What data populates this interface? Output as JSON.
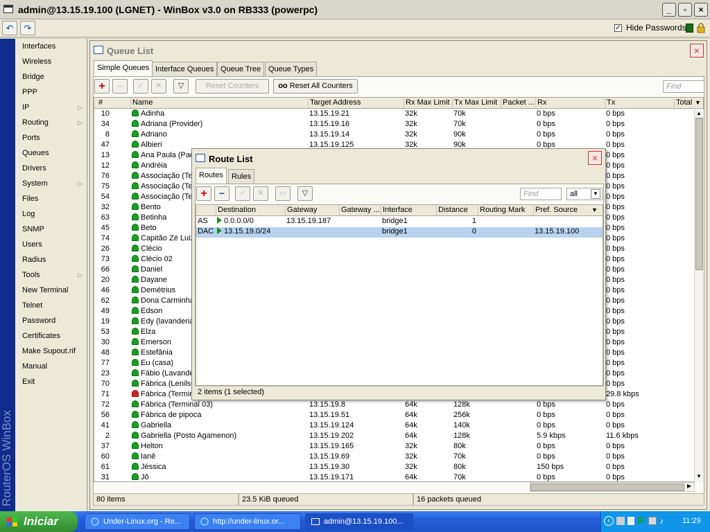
{
  "app": {
    "title": "admin@13.15.19.100 (LGNET) - WinBox v3.0 on RB333 (powerpc)"
  },
  "toolbar": {
    "hide_passwords_label": "Hide Passwords",
    "hide_passwords_checked": true
  },
  "sidebar": {
    "brand": "RouterOS WinBox",
    "items": [
      {
        "label": "Interfaces",
        "has_submenu": false
      },
      {
        "label": "Wireless",
        "has_submenu": false
      },
      {
        "label": "Bridge",
        "has_submenu": false
      },
      {
        "label": "PPP",
        "has_submenu": false
      },
      {
        "label": "IP",
        "has_submenu": true
      },
      {
        "label": "Routing",
        "has_submenu": true
      },
      {
        "label": "Ports",
        "has_submenu": false
      },
      {
        "label": "Queues",
        "has_submenu": false
      },
      {
        "label": "Drivers",
        "has_submenu": false
      },
      {
        "label": "System",
        "has_submenu": true
      },
      {
        "label": "Files",
        "has_submenu": false
      },
      {
        "label": "Log",
        "has_submenu": false
      },
      {
        "label": "SNMP",
        "has_submenu": false
      },
      {
        "label": "Users",
        "has_submenu": false
      },
      {
        "label": "Radius",
        "has_submenu": false
      },
      {
        "label": "Tools",
        "has_submenu": true
      },
      {
        "label": "New Terminal",
        "has_submenu": false
      },
      {
        "label": "Telnet",
        "has_submenu": false
      },
      {
        "label": "Password",
        "has_submenu": false
      },
      {
        "label": "Certificates",
        "has_submenu": false
      },
      {
        "label": "Make Supout.rif",
        "has_submenu": false
      },
      {
        "label": "Manual",
        "has_submenu": false
      },
      {
        "label": "Exit",
        "has_submenu": false
      }
    ]
  },
  "queue_list": {
    "title": "Queue List",
    "tabs": [
      "Simple Queues",
      "Interface Queues",
      "Queue Tree",
      "Queue Types"
    ],
    "active_tab": "Simple Queues",
    "reset_counters": "Reset Counters",
    "reset_all_counters": "Reset All Counters",
    "oo_label": "oo",
    "find_placeholder": "Find",
    "columns": [
      "#",
      "Name",
      "Target Address",
      "Rx Max Limit",
      "Tx Max Limit",
      "Packet ...",
      "Rx",
      "Tx",
      "Total"
    ],
    "rows": [
      {
        "n": "10",
        "name": "Adinha",
        "target": "13.15.19.21",
        "rxmax": "32k",
        "txmax": "70k",
        "rx": "0 bps",
        "tx": "0 bps",
        "status": "green"
      },
      {
        "n": "34",
        "name": "Adriana (Provider)",
        "target": "13.15.19.16",
        "rxmax": "32k",
        "txmax": "70k",
        "rx": "0 bps",
        "tx": "0 bps",
        "status": "green"
      },
      {
        "n": "8",
        "name": "Adriano",
        "target": "13.15.19.14",
        "rxmax": "32k",
        "txmax": "90k",
        "rx": "0 bps",
        "tx": "0 bps",
        "status": "green"
      },
      {
        "n": "47",
        "name": "Albieri",
        "target": "13.15.19.125",
        "rxmax": "32k",
        "txmax": "90k",
        "rx": "0 bps",
        "tx": "0 bps",
        "status": "green"
      },
      {
        "n": "13",
        "name": "Ana Paula (Pad",
        "target": "",
        "rxmax": "",
        "txmax": "",
        "rx": "",
        "tx": "0 bps",
        "status": "green"
      },
      {
        "n": "12",
        "name": "Andréia",
        "target": "",
        "rxmax": "",
        "txmax": "",
        "rx": "",
        "tx": "0 bps",
        "status": "green"
      },
      {
        "n": "76",
        "name": "Associação (Te",
        "target": "",
        "rxmax": "",
        "txmax": "",
        "rx": "",
        "tx": "0 bps",
        "status": "green"
      },
      {
        "n": "75",
        "name": "Associação (Te",
        "target": "",
        "rxmax": "",
        "txmax": "",
        "rx": "",
        "tx": "0 bps",
        "status": "green"
      },
      {
        "n": "54",
        "name": "Associação (Te",
        "target": "",
        "rxmax": "",
        "txmax": "",
        "rx": "",
        "tx": "0 bps",
        "status": "green"
      },
      {
        "n": "32",
        "name": "Bento",
        "target": "",
        "rxmax": "",
        "txmax": "",
        "rx": "",
        "tx": "0 bps",
        "status": "green"
      },
      {
        "n": "63",
        "name": "Betinha",
        "target": "",
        "rxmax": "",
        "txmax": "",
        "rx": "",
        "tx": "0 bps",
        "status": "green"
      },
      {
        "n": "45",
        "name": "Beto",
        "target": "",
        "rxmax": "",
        "txmax": "",
        "rx": "",
        "tx": "0 bps",
        "status": "green"
      },
      {
        "n": "74",
        "name": "Capitão Zé Luiz",
        "target": "",
        "rxmax": "",
        "txmax": "",
        "rx": "",
        "tx": "0 bps",
        "status": "green"
      },
      {
        "n": "26",
        "name": "Clécio",
        "target": "",
        "rxmax": "",
        "txmax": "",
        "rx": "",
        "tx": "0 bps",
        "status": "green"
      },
      {
        "n": "73",
        "name": "Clécio 02",
        "target": "",
        "rxmax": "",
        "txmax": "",
        "rx": "",
        "tx": "0 bps",
        "status": "green"
      },
      {
        "n": "66",
        "name": "Daniel",
        "target": "",
        "rxmax": "",
        "txmax": "",
        "rx": "",
        "tx": "0 bps",
        "status": "green"
      },
      {
        "n": "20",
        "name": "Dayane",
        "target": "",
        "rxmax": "",
        "txmax": "",
        "rx": "",
        "tx": "0 bps",
        "status": "green"
      },
      {
        "n": "46",
        "name": "Demétrius",
        "target": "",
        "rxmax": "",
        "txmax": "",
        "rx": "",
        "tx": "0 bps",
        "status": "green"
      },
      {
        "n": "62",
        "name": "Dona Carminha",
        "target": "",
        "rxmax": "",
        "txmax": "",
        "rx": "",
        "tx": "0 bps",
        "status": "green"
      },
      {
        "n": "49",
        "name": "Edson",
        "target": "",
        "rxmax": "",
        "txmax": "",
        "rx": "",
        "tx": "0 bps",
        "status": "green"
      },
      {
        "n": "19",
        "name": "Edy (lavanderia",
        "target": "",
        "rxmax": "",
        "txmax": "",
        "rx": "",
        "tx": "0 bps",
        "status": "green"
      },
      {
        "n": "53",
        "name": "Elza",
        "target": "",
        "rxmax": "",
        "txmax": "",
        "rx": "",
        "tx": "0 bps",
        "status": "green"
      },
      {
        "n": "30",
        "name": "Emerson",
        "target": "",
        "rxmax": "",
        "txmax": "",
        "rx": "",
        "tx": "0 bps",
        "status": "green"
      },
      {
        "n": "48",
        "name": "Estefânia",
        "target": "",
        "rxmax": "",
        "txmax": "",
        "rx": "",
        "tx": "0 bps",
        "status": "green"
      },
      {
        "n": "77",
        "name": "Eu (casa)",
        "target": "",
        "rxmax": "",
        "txmax": "",
        "rx": "",
        "tx": "0 bps",
        "status": "green"
      },
      {
        "n": "23",
        "name": "Fábio (Lavande",
        "target": "",
        "rxmax": "",
        "txmax": "",
        "rx": "",
        "tx": "0 bps",
        "status": "green"
      },
      {
        "n": "70",
        "name": "Fábrica (Lenilso",
        "target": "",
        "rxmax": "",
        "txmax": "",
        "rx": "",
        "tx": "0 bps",
        "status": "green"
      },
      {
        "n": "71",
        "name": "Fábrica (Termin",
        "target": "",
        "rxmax": "",
        "txmax": "",
        "rx": "",
        "tx": "29.8 kbps",
        "status": "red"
      },
      {
        "n": "72",
        "name": "Fábrica (Terminal 03)",
        "target": "13.15.19.8",
        "rxmax": "64k",
        "txmax": "128k",
        "rx": "0 bps",
        "tx": "0 bps",
        "status": "green"
      },
      {
        "n": "56",
        "name": "Fábrica de pipoca",
        "target": "13.15.19.51",
        "rxmax": "64k",
        "txmax": "256k",
        "rx": "0 bps",
        "tx": "0 bps",
        "status": "green"
      },
      {
        "n": "41",
        "name": "Gabriella",
        "target": "13.15.19.124",
        "rxmax": "64k",
        "txmax": "140k",
        "rx": "0 bps",
        "tx": "0 bps",
        "status": "green"
      },
      {
        "n": "2",
        "name": "Gabriella (Posto Agamenon)",
        "target": "13.15.19.202",
        "rxmax": "64k",
        "txmax": "128k",
        "rx": "5.9 kbps",
        "tx": "11.6 kbps",
        "status": "green"
      },
      {
        "n": "37",
        "name": "Helton",
        "target": "13.15.19.165",
        "rxmax": "32k",
        "txmax": "80k",
        "rx": "0 bps",
        "tx": "0 bps",
        "status": "green"
      },
      {
        "n": "60",
        "name": "Ianê",
        "target": "13.15.19.69",
        "rxmax": "32k",
        "txmax": "70k",
        "rx": "0 bps",
        "tx": "0 bps",
        "status": "green"
      },
      {
        "n": "61",
        "name": "Jéssica",
        "target": "13.15.19.30",
        "rxmax": "32k",
        "txmax": "80k",
        "rx": "150 bps",
        "tx": "0 bps",
        "status": "green"
      },
      {
        "n": "31",
        "name": "Jô",
        "target": "13.15.19.171",
        "rxmax": "64k",
        "txmax": "70k",
        "rx": "0 bps",
        "tx": "0 bps",
        "status": "green"
      }
    ],
    "status": {
      "items": "80 items",
      "queued_bytes": "23.5 KiB queued",
      "queued_packets": "16 packets queued"
    }
  },
  "route_list": {
    "title": "Route List",
    "tabs": [
      "Routes",
      "Rules"
    ],
    "active_tab": "Routes",
    "find_placeholder": "Find",
    "filter_value": "all",
    "columns": [
      "",
      "Destination",
      "Gateway",
      "Gateway ...",
      "Interface",
      "Distance",
      "Routing Mark",
      "Pref. Source"
    ],
    "rows": [
      {
        "flags": "AS",
        "destination": "0.0.0.0/0",
        "gateway": "13.15.19.187",
        "gateway_state": "",
        "interface": "bridge1",
        "distance": "1",
        "routing_mark": "",
        "pref_source": "",
        "selected": false
      },
      {
        "flags": "DAC",
        "destination": "13.15.19.0/24",
        "gateway": "",
        "gateway_state": "",
        "interface": "bridge1",
        "distance": "0",
        "routing_mark": "",
        "pref_source": "13.15.19.100",
        "selected": true
      }
    ],
    "status": "2 items (1 selected)"
  },
  "taskbar": {
    "start_label": "Iniciar",
    "tasks": [
      "Under-Linux.org - Re...",
      "http://under-linux.or...",
      "admin@13.15.19.100..."
    ],
    "clock": "11:29"
  }
}
